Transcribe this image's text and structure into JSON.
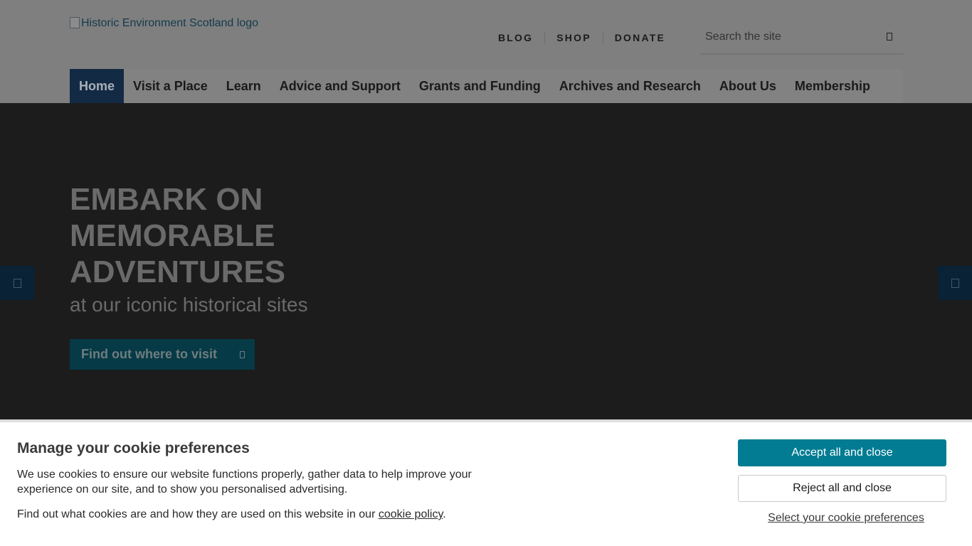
{
  "header": {
    "logo_alt": "Historic Environment Scotland logo",
    "utility_nav": [
      "BLOG",
      "SHOP",
      "DONATE"
    ],
    "search": {
      "placeholder": "Search the site",
      "value": ""
    }
  },
  "main_nav": [
    {
      "label": "Home",
      "active": true
    },
    {
      "label": "Visit a Place"
    },
    {
      "label": "Learn"
    },
    {
      "label": "Advice and Support"
    },
    {
      "label": "Grants and Funding"
    },
    {
      "label": "Archives and Research"
    },
    {
      "label": "About Us"
    },
    {
      "label": "Membership"
    }
  ],
  "hero": {
    "title": "EMBARK ON MEMORABLE ADVENTURES",
    "subtitle": "at our iconic historical sites",
    "cta_label": "Find out where to visit"
  },
  "cookie_banner": {
    "title": "Manage your cookie preferences",
    "text": "We use cookies to ensure our website functions properly, gather data to help improve your experience on our site, and to show you personalised advertising.",
    "policy_prefix": "Find out what cookies are and how they are used on this website in our ",
    "policy_link": "cookie policy",
    "policy_suffix": ".",
    "accept_label": "Accept all and close",
    "reject_label": "Reject all and close",
    "preferences_label": "Select your cookie preferences"
  },
  "colors": {
    "accent": "#017c92",
    "nav_active_bg": "#132a45",
    "hero_bg": "#1c1c1c",
    "overlay": "#7f7f7f"
  },
  "icons": {
    "search": "search-icon",
    "cta": "arrow-right-icon",
    "slide_prev": "chevron-left-icon",
    "slide_next": "chevron-right-icon"
  }
}
